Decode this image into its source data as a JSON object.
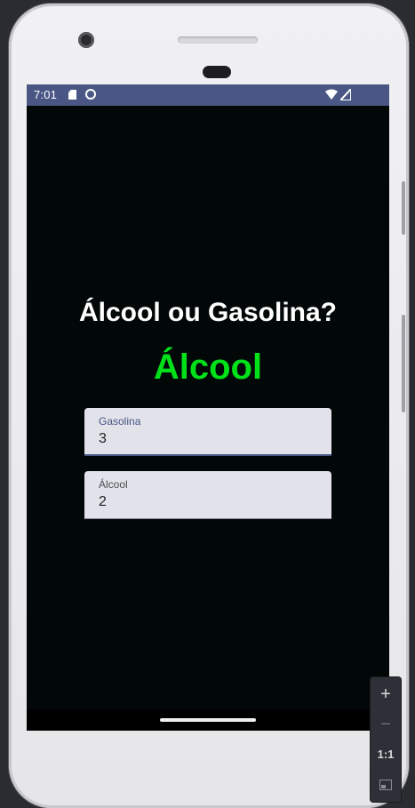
{
  "status_bar": {
    "time": "7:01",
    "icons": [
      "sd-card-icon",
      "app-notification-icon",
      "wifi-icon",
      "signal-icon"
    ]
  },
  "app": {
    "title": "Álcool ou Gasolina?",
    "result": "Álcool",
    "result_color": "#00e11a",
    "background": "#020708",
    "accent": "#4a5785"
  },
  "form": {
    "gasolina": {
      "label": "Gasolina",
      "value": "3"
    },
    "alcool": {
      "label": "Álcool",
      "value": "2"
    }
  },
  "emulator_zoom": {
    "zoom_in": "+",
    "zoom_out": "−",
    "actual_size": "1:1"
  }
}
